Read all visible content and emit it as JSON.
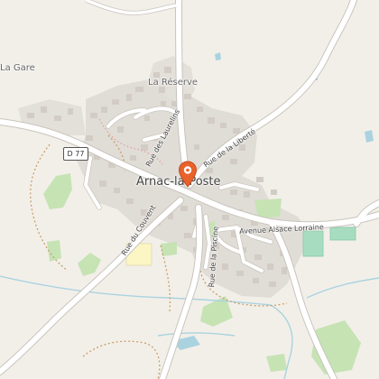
{
  "colors": {
    "background": "#f2efe9",
    "road": "#ffffff",
    "road_casing": "#c9c4bd",
    "built_area": "#e0dcd6",
    "building": "#d2ccc4",
    "forest": "#c6e3b4",
    "sports": "#a8dcc0",
    "water": "#aad3df",
    "school": "#fbf6c4",
    "footpath": "#c9a06a",
    "marker": "#e8622c"
  },
  "map": {
    "places": {
      "la_gare": "La Gare",
      "la_reserve": "La Réserve",
      "town": "Arnac-la-Poste"
    },
    "road_ref": "D 77",
    "streets": {
      "laurelins": "Rue des Laurelins",
      "liberte": "Rue de la Liberté",
      "couvent": "Rue du Couvent",
      "piscine": "Rue de la Piscine",
      "alsace": "Avenue Alsace Lorraine"
    },
    "marker_icon": "map-pin-icon"
  }
}
